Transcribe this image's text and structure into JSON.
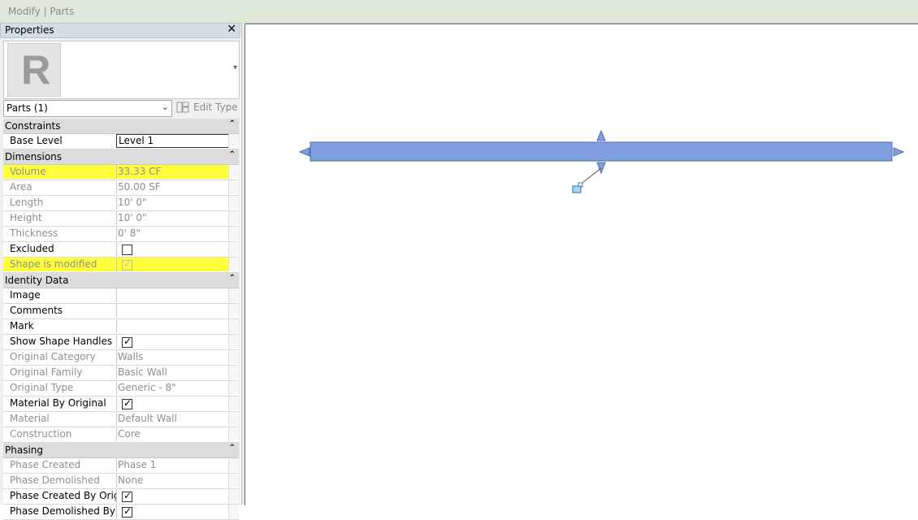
{
  "ribbon": {
    "title": "Modify | Parts"
  },
  "panel": {
    "title": "Properties",
    "type_selector": "Parts (1)",
    "edit_type_label": "Edit Type"
  },
  "sections": {
    "constraints": {
      "title": "Constraints",
      "base_level_label": "Base Level",
      "base_level_value": "Level 1"
    },
    "dimensions": {
      "title": "Dimensions",
      "volume_label": "Volume",
      "volume_value": "33.33 CF",
      "area_label": "Area",
      "area_value": "50.00 SF",
      "length_label": "Length",
      "length_value": "10'  0\"",
      "height_label": "Height",
      "height_value": "10'  0\"",
      "thickness_label": "Thickness",
      "thickness_value": "0'  8\"",
      "excluded_label": "Excluded",
      "excluded_checked": false,
      "shape_modified_label": "Shape is modified",
      "shape_modified_checked": true
    },
    "identity": {
      "title": "Identity Data",
      "image_label": "Image",
      "image_value": "",
      "comments_label": "Comments",
      "comments_value": "",
      "mark_label": "Mark",
      "mark_value": "",
      "show_handles_label": "Show Shape Handles",
      "show_handles_checked": true,
      "orig_category_label": "Original Category",
      "orig_category_value": "Walls",
      "orig_family_label": "Original Family",
      "orig_family_value": "Basic Wall",
      "orig_type_label": "Original Type",
      "orig_type_value": "Generic - 8\"",
      "material_by_orig_label": "Material By Original",
      "material_by_orig_checked": true,
      "material_label": "Material",
      "material_value": "Default Wall",
      "construction_label": "Construction",
      "construction_value": "Core"
    },
    "phasing": {
      "title": "Phasing",
      "phase_created_label": "Phase Created",
      "phase_created_value": "Phase 1",
      "phase_demolished_label": "Phase Demolished",
      "phase_demolished_value": "None",
      "phase_created_by_orig_label": "Phase Created By Origi...",
      "phase_created_by_orig_checked": true,
      "phase_demolished_by_label": "Phase Demolished By ...",
      "phase_demolished_by_checked": true
    }
  },
  "colors": {
    "highlight": "#ffff3b",
    "wall_fill": "#7f9fdf",
    "handle": "#4f6fa8"
  },
  "icons": {
    "close": "close-icon",
    "collapse": "collapse-up-icon",
    "logo": "revit-logo",
    "edit_type": "edit-type-icon"
  }
}
